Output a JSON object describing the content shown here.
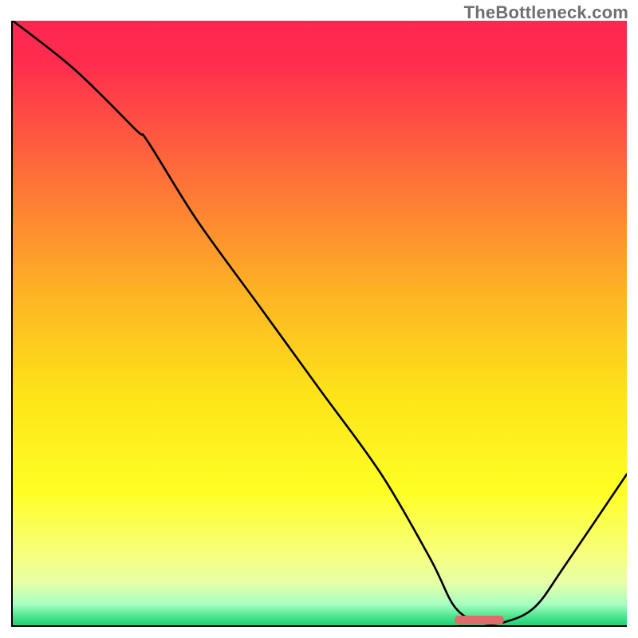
{
  "watermark": "TheBottleneck.com",
  "chart_data": {
    "type": "line",
    "title": "",
    "xlabel": "",
    "ylabel": "",
    "xlim": [
      0,
      100
    ],
    "ylim": [
      0,
      100
    ],
    "grid": false,
    "legend": false,
    "series": [
      {
        "name": "bottleneck-curve",
        "x": [
          0,
          10,
          20,
          22,
          30,
          40,
          50,
          60,
          68,
          72,
          76,
          80,
          85,
          90,
          100
        ],
        "y": [
          100,
          92,
          82,
          80,
          67,
          53,
          39,
          25,
          11,
          3,
          0.5,
          0.5,
          3,
          10,
          25
        ]
      }
    ],
    "background_gradient": {
      "stops": [
        {
          "pos": 0.0,
          "color": "#ff2651"
        },
        {
          "pos": 0.07,
          "color": "#ff2d4e"
        },
        {
          "pos": 0.25,
          "color": "#fe6d3a"
        },
        {
          "pos": 0.45,
          "color": "#fdb325"
        },
        {
          "pos": 0.62,
          "color": "#fde418"
        },
        {
          "pos": 0.78,
          "color": "#feff25"
        },
        {
          "pos": 0.88,
          "color": "#f7ff7b"
        },
        {
          "pos": 0.93,
          "color": "#e6ffa8"
        },
        {
          "pos": 0.965,
          "color": "#a8ffc2"
        },
        {
          "pos": 0.985,
          "color": "#4de68f"
        },
        {
          "pos": 1.0,
          "color": "#1fcf76"
        }
      ]
    },
    "marker": {
      "name": "optimal-range-pill",
      "x_start": 72,
      "x_end": 80,
      "y": 0.8,
      "color": "#e16a6a"
    }
  }
}
